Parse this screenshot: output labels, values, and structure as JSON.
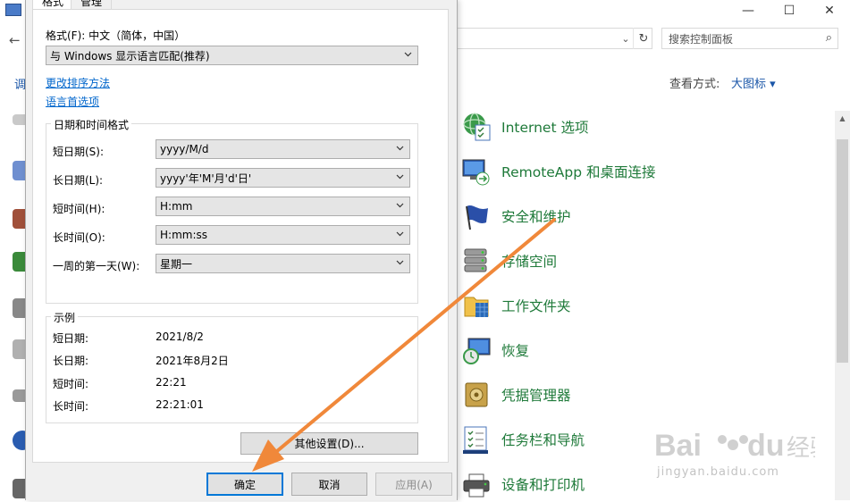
{
  "background_window": {
    "search_placeholder": "搜索控制面板",
    "view_label": "查看方式:",
    "view_value": "大图标 ▾",
    "left_partial_text": "调",
    "items": [
      {
        "label": "Internet 选项",
        "icon": "internet-options-icon"
      },
      {
        "label": "RemoteApp 和桌面连接",
        "icon": "remoteapp-icon"
      },
      {
        "label": "安全和维护",
        "icon": "security-flag-icon"
      },
      {
        "label": "存储空间",
        "icon": "storage-spaces-icon"
      },
      {
        "label": "工作文件夹",
        "icon": "work-folders-icon"
      },
      {
        "label": "恢复",
        "icon": "recovery-icon"
      },
      {
        "label": "凭据管理器",
        "icon": "credential-manager-icon"
      },
      {
        "label": "任务栏和导航",
        "icon": "taskbar-icon"
      },
      {
        "label": "设备和打印机",
        "icon": "printer-icon"
      }
    ]
  },
  "dialog": {
    "tabs": [
      "格式",
      "管理"
    ],
    "format_label": "格式(F): 中文（简体，中国）",
    "format_value": "与 Windows 显示语言匹配(推荐)",
    "link_sort": "更改排序方法",
    "link_lang": "语言首选项",
    "datetime_group": "日期和时间格式",
    "fields": [
      {
        "label": "短日期(S):",
        "value": "yyyy/M/d"
      },
      {
        "label": "长日期(L):",
        "value": "yyyy'年'M'月'd'日'"
      },
      {
        "label": "短时间(H):",
        "value": "H:mm"
      },
      {
        "label": "长时间(O):",
        "value": "H:mm:ss"
      },
      {
        "label": "一周的第一天(W):",
        "value": "星期一"
      }
    ],
    "example_group": "示例",
    "examples": [
      {
        "label": "短日期:",
        "value": "2021/8/2"
      },
      {
        "label": "长日期:",
        "value": "2021年8月2日"
      },
      {
        "label": "短时间:",
        "value": "22:21"
      },
      {
        "label": "长时间:",
        "value": "22:21:01"
      }
    ],
    "other_settings": "其他设置(D)...",
    "ok": "确定",
    "cancel": "取消",
    "apply": "应用(A)"
  },
  "watermark": {
    "text": "jingyan.baidu.com"
  },
  "colors": {
    "accent_blue": "#0078d7",
    "link_blue": "#0066cc",
    "item_green": "#1f7a3a",
    "arrow_orange": "#f0883a"
  }
}
